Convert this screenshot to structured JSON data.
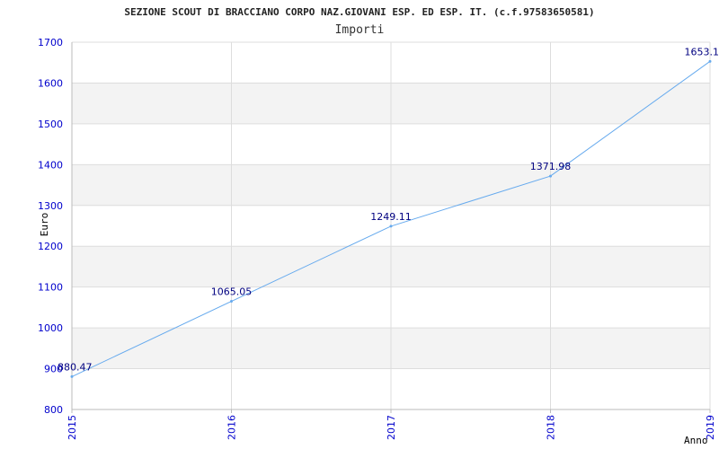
{
  "chart_data": {
    "type": "line",
    "title": "SEZIONE SCOUT DI BRACCIANO CORPO NAZ.GIOVANI ESP. ED ESP. IT. (c.f.97583650581)",
    "subtitle": "Importi",
    "xlabel": "Anno",
    "ylabel": "Euro",
    "categories": [
      "2015",
      "2016",
      "2017",
      "2018",
      "2019"
    ],
    "series": [
      {
        "values": [
          880.47,
          1065.05,
          1249.11,
          1371.98,
          1653.1
        ]
      }
    ],
    "data_labels": [
      "880.47",
      "1065.05",
      "1249.11",
      "1371.98",
      "1653.1"
    ],
    "ylim": [
      800,
      1700
    ],
    "yticks": [
      "800",
      "900",
      "1000",
      "1100",
      "1200",
      "1300",
      "1400",
      "1500",
      "1600",
      "1700"
    ],
    "grid": true,
    "colors": {
      "line": "#66aaee",
      "band": "#f3f3f3",
      "grid": "#dddddd",
      "tick_text": "#0000cc",
      "data_label": "#000080"
    }
  }
}
